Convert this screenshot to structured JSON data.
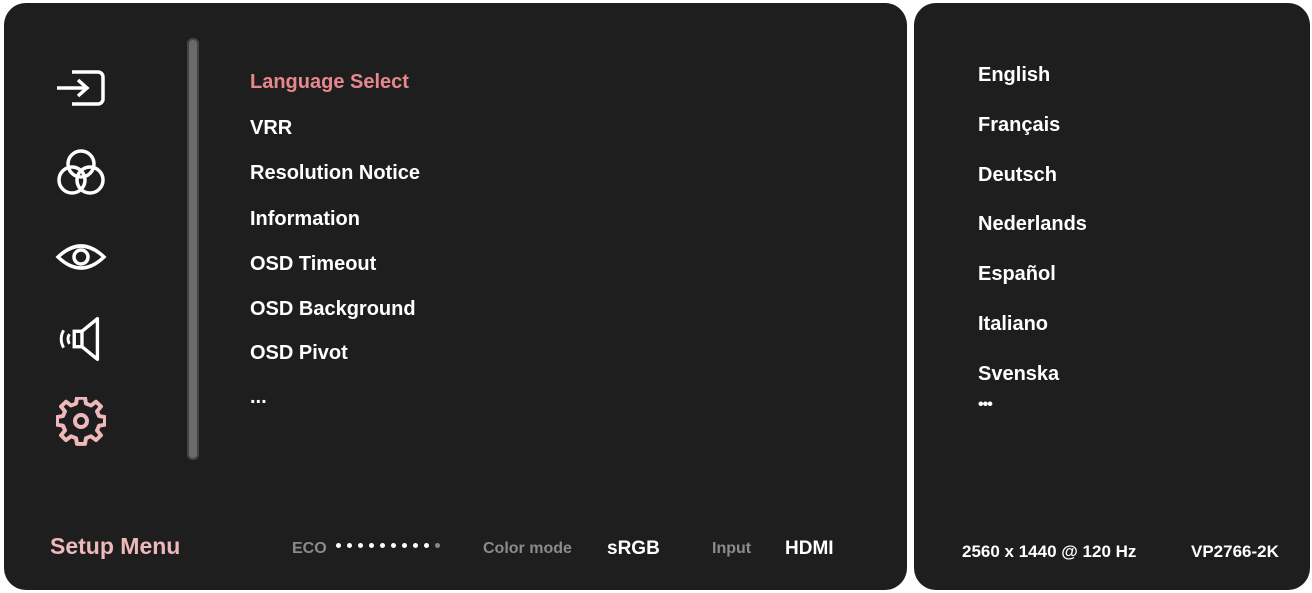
{
  "sidebar": {
    "icons": [
      {
        "name": "input-icon"
      },
      {
        "name": "color-icon"
      },
      {
        "name": "eye-icon"
      },
      {
        "name": "audio-icon"
      },
      {
        "name": "gear-icon",
        "active": true
      }
    ]
  },
  "menu": {
    "items": [
      {
        "label": "Language Select",
        "active": true
      },
      {
        "label": "VRR"
      },
      {
        "label": "Resolution Notice"
      },
      {
        "label": "Information"
      },
      {
        "label": "OSD Timeout"
      },
      {
        "label": "OSD Background"
      },
      {
        "label": "OSD Pivot"
      },
      {
        "label": "..."
      }
    ]
  },
  "footer": {
    "title": "Setup Menu",
    "eco_label": "ECO",
    "eco_level": "9/10",
    "color_mode_label": "Color mode",
    "color_mode_value": "sRGB",
    "input_label": "Input",
    "input_value": "HDMI"
  },
  "languages": {
    "items": [
      "English",
      "Français",
      "Deutsch",
      "Nederlands",
      "Español",
      "Italiano",
      "Svenska",
      "•••"
    ]
  },
  "status": {
    "resolution": "2560 x 1440 @ 120 Hz",
    "model": "VP2766-2K"
  },
  "colors": {
    "panel_bg": "#1e1e1e",
    "accent": "#e7888d",
    "title_accent": "#efb9bb",
    "text": "#ffffff",
    "muted": "#8b8b8b"
  }
}
